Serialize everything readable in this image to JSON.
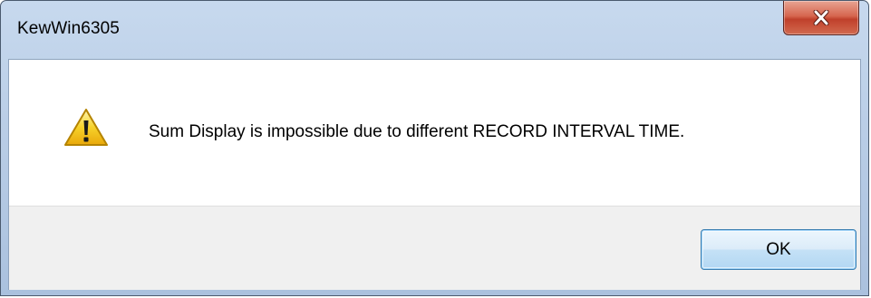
{
  "window": {
    "title": "KewWin6305"
  },
  "dialog": {
    "icon": "warning-icon",
    "message": "Sum Display is impossible due to different RECORD INTERVAL TIME.",
    "ok_label": "OK"
  },
  "colors": {
    "close_button": "#c7432e",
    "warning_yellow": "#f5c711",
    "ok_button_border": "#3c7fb1"
  }
}
